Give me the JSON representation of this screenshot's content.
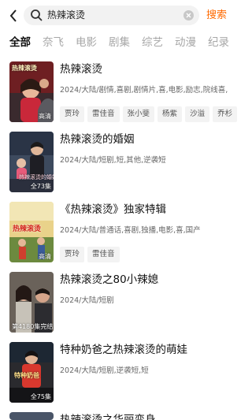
{
  "search": {
    "query": "热辣滚烫",
    "button_label": "搜索"
  },
  "tabs": [
    "全部",
    "奈飞",
    "电影",
    "剧集",
    "综艺",
    "动漫",
    "纪录"
  ],
  "results": [
    {
      "title": "热辣滚烫",
      "meta": "2024/大陆/剧情,喜剧,剧情片,喜,电影,励志,院线喜,",
      "badge": "高清",
      "poster_text": "热辣滚烫",
      "cast": [
        "贾玲",
        "雷佳音",
        "张小斐",
        "杨紫",
        "沙溢",
        "乔杉"
      ]
    },
    {
      "title": "热辣滚烫的婚姻",
      "meta": "2024/大陆/短剧,短,其他,逆袭短",
      "badge": "全73集",
      "poster_text": "热辣滚烫的婚姻",
      "cast": []
    },
    {
      "title": "《热辣滚烫》独家特辑",
      "meta": "2024/大陆/普通话,喜剧,独播,电影,喜,国产",
      "badge": "高清",
      "poster_text": "热辣滚烫",
      "cast": [
        "贾玲",
        "雷佳音"
      ]
    },
    {
      "title": "热辣滚烫之80小辣媳",
      "meta": "2024/大陆/短剧",
      "badge": "第4180集完结",
      "poster_text": "",
      "cast": []
    },
    {
      "title": "特种奶爸之热辣滚烫的萌娃",
      "meta": "2024/大陆/短剧,逆袭短,短",
      "badge": "全75集",
      "poster_text": "特种奶爸",
      "cast": []
    }
  ],
  "partial_next_title": "热辣滚烫之华丽变身",
  "colors": {
    "accent": "#ff6a00",
    "tab_inactive": "#a7a7a7",
    "chip_bg": "#f3f3f3"
  }
}
